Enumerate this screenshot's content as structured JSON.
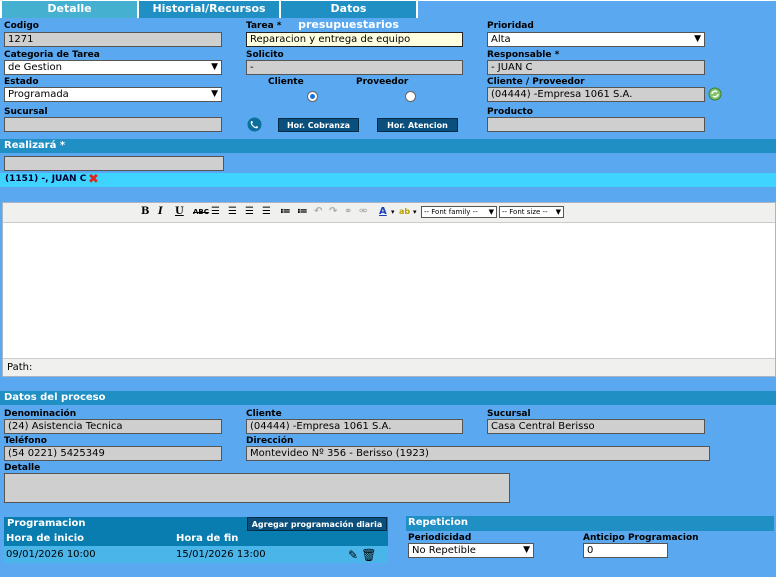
{
  "tabs": [
    "Detalle",
    "Historial/Recursos",
    "Datos presupuestarios"
  ],
  "fields": {
    "codigo_label": "Codigo",
    "codigo": "1271",
    "tarea_label": "Tarea *",
    "tarea": "Reparacion y entrega de equipo",
    "prioridad_label": "Prioridad",
    "prioridad": "Alta",
    "categoria_label": "Categoria de Tarea",
    "categoria": "de Gestion",
    "solicito_label": "Solicito",
    "solicito": "-",
    "responsable_label": "Responsable *",
    "responsable": "- JUAN C",
    "estado_label": "Estado",
    "estado": "Programada",
    "cliente_radio_label": "Cliente",
    "proveedor_radio_label": "Proveedor",
    "cliente_proveedor_label": "Cliente / Proveedor",
    "cliente_proveedor": "(04444) -Empresa 1061 S.A.",
    "sucursal_label": "Sucursal",
    "sucursal": "",
    "producto_label": "Producto",
    "producto": ""
  },
  "buttons": {
    "hor_cobranza": "Hor. Cobranza",
    "hor_atencion": "Hor. Atencion",
    "agregar_programacion": "Agregar programación diaria"
  },
  "realizara": {
    "title": "Realizará *",
    "input": "",
    "assignee": "(1151) -, JUAN C"
  },
  "editor": {
    "font_family": "-- Font family --",
    "font_size": "-- Font size --",
    "path_label": "Path:"
  },
  "proceso": {
    "title": "Datos del proceso",
    "denominacion_label": "Denominación",
    "denominacion": "(24) Asistencia Tecnica",
    "cliente_label": "Cliente",
    "cliente": "(04444) -Empresa 1061 S.A.",
    "sucursal_label": "Sucursal",
    "sucursal": "Casa Central Berisso",
    "telefono_label": "Teléfono",
    "telefono": "(54 0221) 5425349",
    "direccion_label": "Dirección",
    "direccion": "Montevideo Nº 356 - Berisso (1923)",
    "detalle_label": "Detalle",
    "detalle": ""
  },
  "programacion": {
    "title": "Programacion",
    "columns": [
      "Hora de inicio",
      "Hora de fin"
    ],
    "rows": [
      {
        "inicio": "09/01/2026 10:00",
        "fin": "15/01/2026 13:00"
      }
    ]
  },
  "repeticion": {
    "title": "Repeticion",
    "periodicidad_label": "Periodicidad",
    "periodicidad": "No Repetible",
    "anticipo_label": "Anticipo Programacion",
    "anticipo": "0"
  },
  "colors": {
    "background": "#5aa9f0",
    "section_bar": "#1f8fc4",
    "button": "#0b4f7c"
  }
}
